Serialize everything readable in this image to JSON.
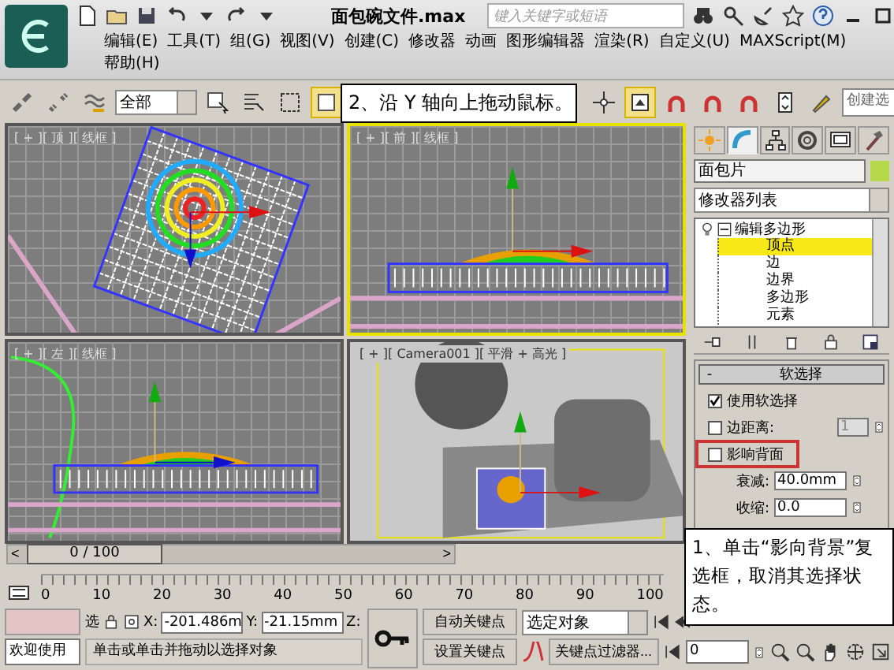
{
  "title_bar": {
    "title": "面包碗文件.max",
    "search": {
      "placeholder": "键入关键字或短语"
    }
  },
  "menu": [
    {
      "label": "编辑(E)"
    },
    {
      "label": "工具(T)"
    },
    {
      "label": "组(G)"
    },
    {
      "label": "视图(V)"
    },
    {
      "label": "创建(C)"
    },
    {
      "label": "修改器"
    },
    {
      "label": "动画"
    },
    {
      "label": "图形编辑器"
    },
    {
      "label": "渲染(R)"
    },
    {
      "label": "自定义(U)"
    },
    {
      "label": "MAXScript(M)"
    },
    {
      "label": "帮助(H)"
    }
  ],
  "toolbar": {
    "selection_filter": "全部",
    "named_selection": "创建选"
  },
  "callouts": [
    {
      "text": "2、沿 Y 轴向上拖动鼠标。"
    },
    {
      "text": "1、单击“影向背景”复选框，取消其选择状态。"
    }
  ],
  "viewports": [
    {
      "label": "[ + ][ 顶 ][ 线框 ]",
      "kind": "top",
      "active": false
    },
    {
      "label": "[ + ][ 前 ][ 线框 ]",
      "kind": "front",
      "active": true
    },
    {
      "label": "[ + ][ 左 ][ 线框 ]",
      "kind": "left",
      "active": false
    },
    {
      "label": "[ + ][ Camera001 ][ 平滑 + 高光 ]",
      "kind": "camera",
      "active": false
    }
  ],
  "command_panel": {
    "tabs": [
      {
        "kind": "create",
        "selected": false
      },
      {
        "kind": "modify",
        "selected": true
      },
      {
        "kind": "hierarchy",
        "selected": false
      },
      {
        "kind": "motion",
        "selected": false
      },
      {
        "kind": "display",
        "selected": false
      },
      {
        "kind": "utilities",
        "selected": false
      }
    ],
    "object_name": "面包片",
    "modifier_list": "修改器列表",
    "stack": [
      {
        "label": "编辑多边形",
        "expanded": true,
        "children": [
          {
            "label": "顶点",
            "selected": true
          },
          {
            "label": "边",
            "selected": false
          },
          {
            "label": "边界",
            "selected": false
          },
          {
            "label": "多边形",
            "selected": false
          },
          {
            "label": "元素",
            "selected": false
          }
        ]
      }
    ],
    "rollout": {
      "sign": "-",
      "title": "软选择",
      "rows": [
        {
          "kind": "checkbox",
          "label": "使用软选择",
          "checked": true
        },
        {
          "kind": "checkbox_spinner",
          "label": "边距离:",
          "checked": false,
          "value": "1",
          "disabled": true
        },
        {
          "kind": "checkbox",
          "label": "影响背面",
          "checked": false,
          "highlighted": true
        },
        {
          "kind": "spinner",
          "label": "衰减:",
          "value": "40.0mm"
        },
        {
          "kind": "spinner",
          "label": "收缩:",
          "value": "0.0"
        }
      ]
    }
  },
  "timeline": {
    "prev": "<",
    "position": "0 / 100",
    "next": ">",
    "ticks": [
      "0",
      "10",
      "20",
      "30",
      "40",
      "50",
      "60",
      "70",
      "80",
      "90",
      "100"
    ]
  },
  "status": {
    "welcome": "欢迎使用",
    "lock_label": "选",
    "x_label": "X:",
    "x": "-201.486m",
    "y_label": "Y:",
    "y": "-21.15mm",
    "z_label": "Z:",
    "prompt": "单击或单击并拖动以选择对象",
    "auto_key": "自动关键点",
    "set_key": "设置关键点",
    "key_mode": "选定对象",
    "key_filters": "关键点过滤器...",
    "frame": "0"
  }
}
